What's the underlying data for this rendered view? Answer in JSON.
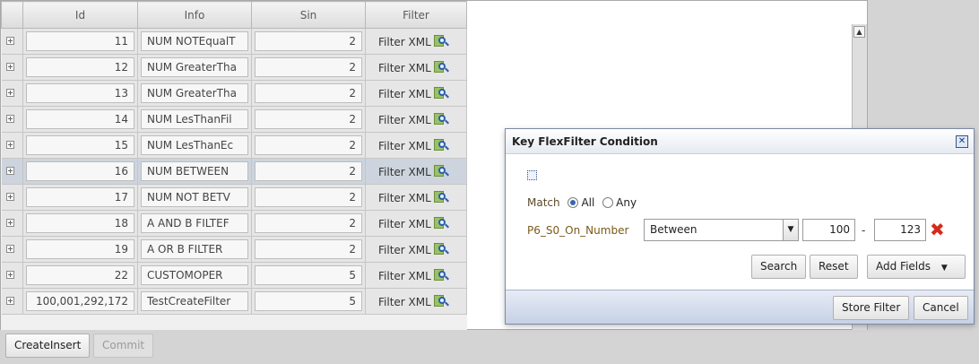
{
  "table": {
    "headers": {
      "id": "Id",
      "info": "Info",
      "sin": "Sin",
      "filter": "Filter"
    },
    "rows": [
      {
        "id": "11",
        "info": "NUM NOTEqualT",
        "sin": "2",
        "filter": "Filter XML"
      },
      {
        "id": "12",
        "info": "NUM GreaterTha",
        "sin": "2",
        "filter": "Filter XML"
      },
      {
        "id": "13",
        "info": "NUM GreaterTha",
        "sin": "2",
        "filter": "Filter XML"
      },
      {
        "id": "14",
        "info": "NUM LesThanFil",
        "sin": "2",
        "filter": "Filter XML"
      },
      {
        "id": "15",
        "info": "NUM LesThanEc",
        "sin": "2",
        "filter": "Filter XML"
      },
      {
        "id": "16",
        "info": "NUM BETWEEN",
        "sin": "2",
        "filter": "Filter XML"
      },
      {
        "id": "17",
        "info": "NUM NOT BETV",
        "sin": "2",
        "filter": "Filter XML"
      },
      {
        "id": "18",
        "info": "A AND B FILTEF",
        "sin": "2",
        "filter": "Filter XML"
      },
      {
        "id": "19",
        "info": "A OR B FILTER",
        "sin": "2",
        "filter": "Filter XML"
      },
      {
        "id": "22",
        "info": "CUSTOMOPER",
        "sin": "5",
        "filter": "Filter XML"
      },
      {
        "id": "100,001,292,172",
        "info": "TestCreateFilter",
        "sin": "5",
        "filter": "Filter XML"
      }
    ],
    "selected_row": "16"
  },
  "toolbar": {
    "create_insert": "CreateInsert",
    "commit": "Commit"
  },
  "dialog": {
    "title": "Key FlexFilter Condition",
    "match_label": "Match",
    "match_all": "All",
    "match_any": "Any",
    "field_name": "P6_S0_On_Number",
    "operator": "Between",
    "value_from": "100",
    "dash": "-",
    "value_to": "123",
    "search": "Search",
    "reset": "Reset",
    "add_fields": "Add Fields",
    "store_filter": "Store Filter",
    "cancel": "Cancel"
  }
}
